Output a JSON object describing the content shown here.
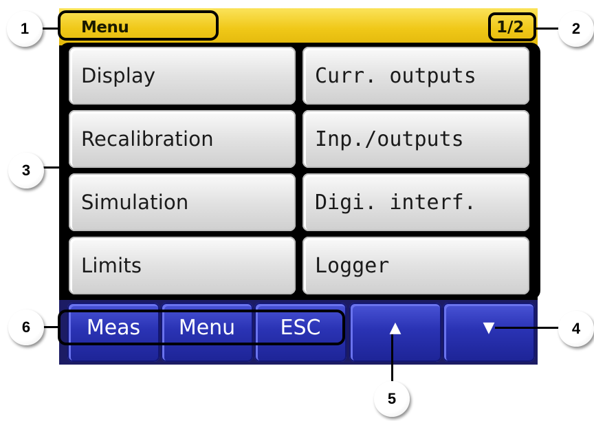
{
  "header": {
    "title": "Menu",
    "page_indicator": "1/2",
    "background_color": "#f0c818"
  },
  "menu": {
    "items": [
      {
        "label": "Display"
      },
      {
        "label": "Curr. outputs"
      },
      {
        "label": "Recalibration"
      },
      {
        "label": "Inp./outputs"
      },
      {
        "label": "Simulation"
      },
      {
        "label": "Digi. interf."
      },
      {
        "label": "Limits"
      },
      {
        "label": "Logger"
      }
    ]
  },
  "softkeys": {
    "meas": "Meas",
    "menu": "Menu",
    "esc": "ESC",
    "up_icon": "up-arrow-icon",
    "down_icon": "down-arrow-icon",
    "color": "#2a33b4"
  },
  "callouts": [
    "1",
    "2",
    "3",
    "4",
    "5",
    "6"
  ]
}
